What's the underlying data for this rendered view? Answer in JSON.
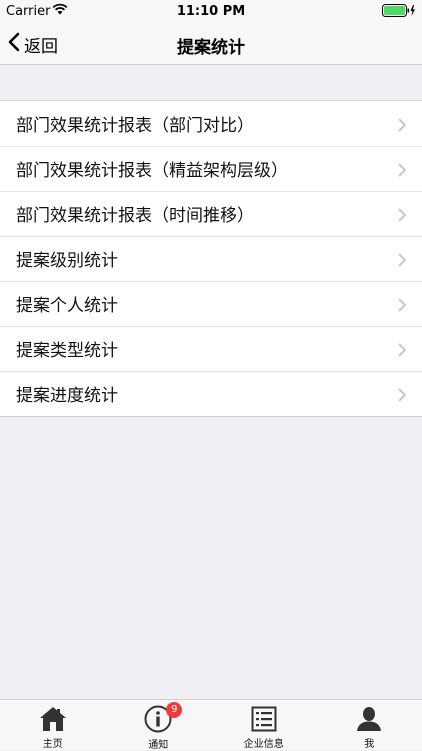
{
  "status_bar": {
    "carrier": "Carrier",
    "time": "11:10 PM"
  },
  "nav": {
    "back_label": "返回",
    "title": "提案统计"
  },
  "menu": {
    "items": [
      {
        "label": "部门效果统计报表（部门对比）"
      },
      {
        "label": "部门效果统计报表（精益架构层级）"
      },
      {
        "label": "部门效果统计报表（时间推移）"
      },
      {
        "label": "提案级别统计"
      },
      {
        "label": "提案个人统计"
      },
      {
        "label": "提案类型统计"
      },
      {
        "label": "提案进度统计"
      }
    ]
  },
  "tab_bar": {
    "tabs": [
      {
        "label": "主页",
        "icon": "home-icon"
      },
      {
        "label": "通知",
        "icon": "info-icon",
        "badge": "9"
      },
      {
        "label": "企业信息",
        "icon": "list-icon"
      },
      {
        "label": "我",
        "icon": "person-icon"
      }
    ]
  },
  "colors": {
    "badge": "#f0393a",
    "background": "#efeff4"
  }
}
